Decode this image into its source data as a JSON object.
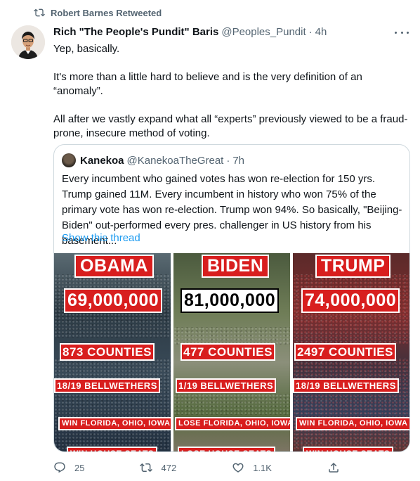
{
  "retweet_banner": {
    "text": "Robert Barnes Retweeted",
    "icon": "retweet-icon"
  },
  "tweet": {
    "author_name": "Rich \"The People's Pundit\" Baris",
    "author_handle": "@Peoples_Pundit",
    "separator": "·",
    "time": "4h",
    "paragraphs": [
      "Yep, basically.",
      "It's more than a little hard to believe and is the very definition of an “anomaly”.",
      "All after we vastly expand what all “experts” previously viewed to be a fraud-prone, insecure method of voting."
    ]
  },
  "quoted_tweet": {
    "author_name": "Kanekoa",
    "author_handle": "@KanekoaTheGreat",
    "separator": "·",
    "time": "7h",
    "text": "Every incumbent who gained votes has won re-election for 150 yrs. Trump gained 11M. Every incumbent in history who won 75% of the primary vote has won re-election. Trump won 94%. So basically, \"Beijing-Biden\" out-performed every pres. challenger in US history from his basement...",
    "show_thread": "Show this thread",
    "image": {
      "columns": [
        {
          "name": "OBAMA",
          "votes": "69,000,000",
          "counties": "873 COUNTIES",
          "bellwethers": "18/19 BELLWETHERS",
          "states": "WIN FLORIDA, OHIO, IOWA",
          "seats": "WIN HOUSE SEATS"
        },
        {
          "name": "BIDEN",
          "votes": "81,000,000",
          "counties": "477 COUNTIES",
          "bellwethers": "1/19 BELLWETHERS",
          "states": "LOSE FLORIDA, OHIO, IOWA",
          "seats": "LOSE HOUSE SEATS"
        },
        {
          "name": "TRUMP",
          "votes": "74,000,000",
          "counties": "2497 COUNTIES",
          "bellwethers": "18/19 BELLWETHERS",
          "states": "WIN FLORIDA, OHIO, IOWA",
          "seats": "WIN HOUSE SEATS"
        }
      ]
    }
  },
  "actions": {
    "reply": {
      "icon": "reply-icon",
      "count": "25"
    },
    "retweet": {
      "icon": "retweet-icon",
      "count": "472"
    },
    "like": {
      "icon": "heart-icon",
      "count": "1.1K"
    },
    "share": {
      "icon": "share-icon",
      "count": ""
    }
  },
  "colors": {
    "label_red": "#d81e1e",
    "link_blue": "#1d9bf0",
    "secondary_text": "#536471"
  }
}
